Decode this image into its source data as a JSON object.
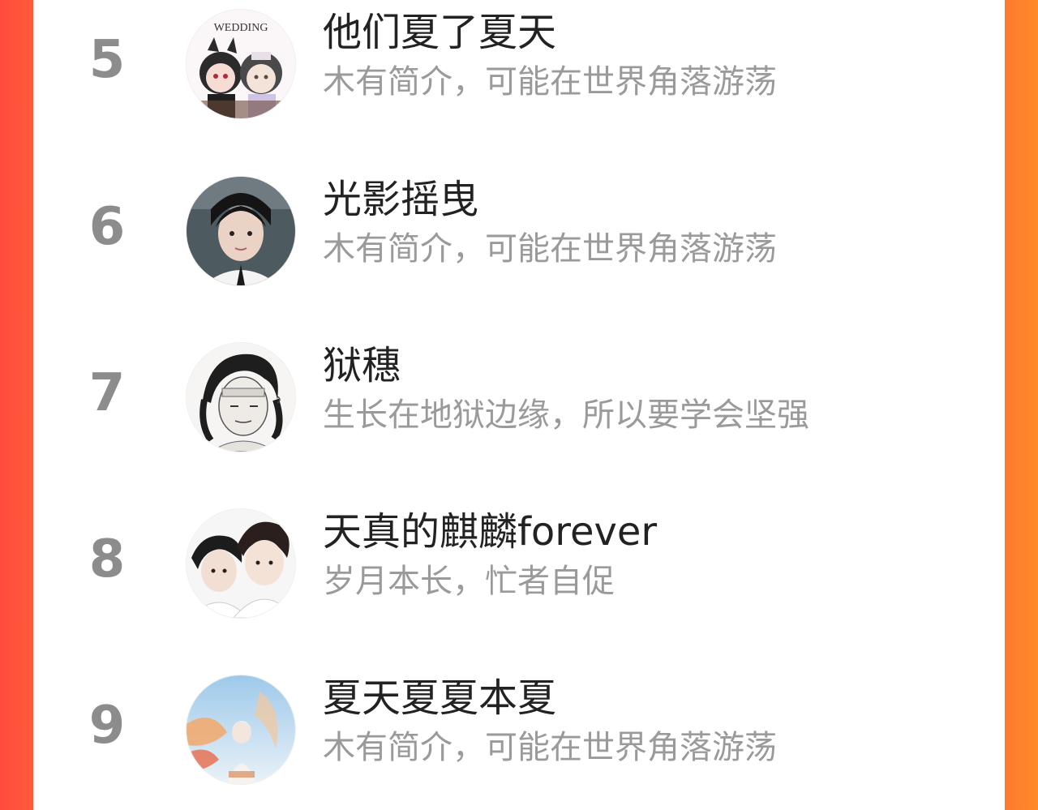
{
  "ranking": {
    "items": [
      {
        "rank": "5",
        "name": "他们夏了夏天",
        "bio": "木有简介，可能在世界角落游荡",
        "avatar_icon": "wedding-couple-avatar",
        "avatar_badge": "WEDDING"
      },
      {
        "rank": "6",
        "name": "光影摇曳",
        "bio": "木有简介，可能在世界角落游荡",
        "avatar_icon": "boy-portrait-avatar"
      },
      {
        "rank": "7",
        "name": "狱穗",
        "bio": "生长在地狱边缘，所以要学会坚强",
        "avatar_icon": "sketch-character-avatar"
      },
      {
        "rank": "8",
        "name": "天真的麒麟forever",
        "bio": "岁月本长，忙者自促",
        "avatar_icon": "two-boys-avatar"
      },
      {
        "rank": "9",
        "name": "夏天夏夏本夏",
        "bio": "木有简介，可能在世界角落游荡",
        "avatar_icon": "sky-painting-avatar"
      }
    ]
  },
  "colors": {
    "side_gradient_left": "#ff4b3e",
    "side_gradient_right": "#ff8a2a",
    "rank_text": "#8c8c8c",
    "name_text": "#222222",
    "bio_text": "#9a9a9a"
  }
}
